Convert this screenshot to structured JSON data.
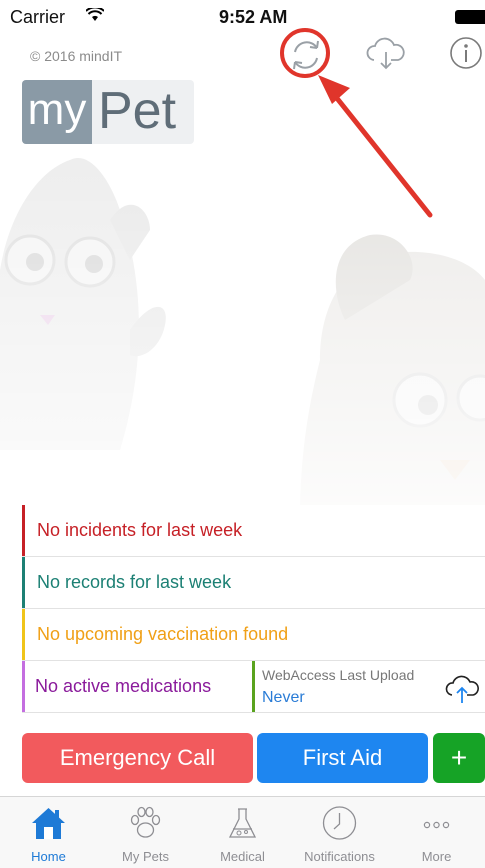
{
  "status_bar": {
    "carrier": "Carrier",
    "time": "9:52 AM"
  },
  "header": {
    "copyright": "© 2016 mindIT",
    "logo_my": "my",
    "logo_pet": "Pet",
    "icons": [
      "sync-icon",
      "cloud-download-icon",
      "info-icon"
    ]
  },
  "summary": {
    "incidents": "No incidents for last week",
    "records": "No records for last week",
    "vaccination": "No upcoming vaccination found",
    "medications": "No active medications",
    "webaccess_label": "WebAccess Last Upload",
    "webaccess_value": "Never"
  },
  "actions": {
    "emergency": "Emergency Call",
    "first_aid": "First Aid",
    "add": "+"
  },
  "tabs": [
    {
      "label": "Home",
      "icon": "home-icon"
    },
    {
      "label": "My Pets",
      "icon": "paw-icon"
    },
    {
      "label": "Medical",
      "icon": "medical-flask-icon"
    },
    {
      "label": "Notifications",
      "icon": "clock-icon"
    },
    {
      "label": "More",
      "icon": "more-icon"
    }
  ],
  "colors": {
    "incidents": "#c62026",
    "records": "#1c8074",
    "vaccination": "#f0a017",
    "medications": "#8a1a9b",
    "webaccess_bar": "#5aa31e",
    "emergency": "#f25a5d",
    "first_aid": "#1e86f0",
    "add": "#16a326",
    "tab_active": "#1e7ad6",
    "annotation": "#e0352b"
  }
}
